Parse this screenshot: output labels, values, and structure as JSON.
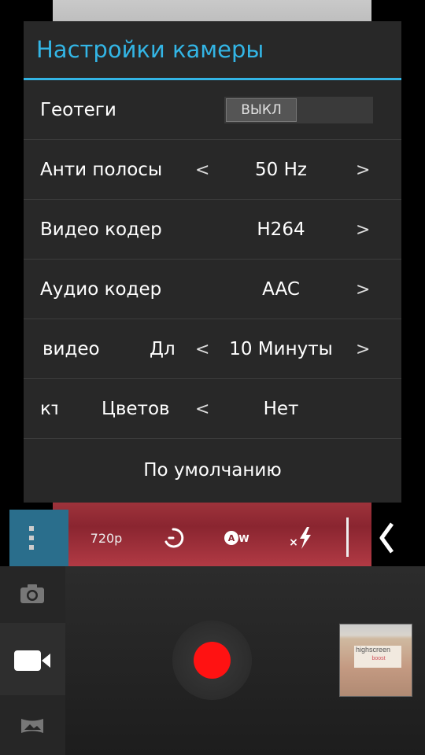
{
  "dialog": {
    "title": "Настройки камеры",
    "geotag": {
      "label": "Геотеги",
      "toggle_value": "ВЫКЛ"
    },
    "antibanding": {
      "label": "Анти полосы",
      "value": "50 Hz",
      "prev": "<",
      "next": ">"
    },
    "video_encoder": {
      "label": "Видео кодер",
      "value": "H264",
      "next": ">"
    },
    "audio_encoder": {
      "label": "Аудио кодер",
      "value": "AAC",
      "next": ">"
    },
    "video_duration": {
      "label_part1": "видео",
      "label_part2": "Дл",
      "value": "10 Минуты",
      "prev": "<",
      "next": ">"
    },
    "color_effect": {
      "label_part1": "кт",
      "label_part2": "Цветов",
      "value": "Нет",
      "prev": "<"
    },
    "defaults_label": "По умолчанию"
  },
  "toolbar": {
    "resolution": "720p",
    "timer_icon": "timer-icon",
    "white_balance_icon": "auto-white-balance-icon",
    "flash_icon": "flash-off-icon",
    "collapse_icon": "chevron-left-icon"
  },
  "modes": [
    "camera-mode-icon",
    "video-mode-icon",
    "panorama-mode-icon"
  ],
  "thumbnail": {
    "brand": "highscreen",
    "sub": "boost"
  },
  "colors": {
    "accent": "#33b5e5",
    "record": "#ff1212",
    "menu_button": "#2a6e8c"
  }
}
